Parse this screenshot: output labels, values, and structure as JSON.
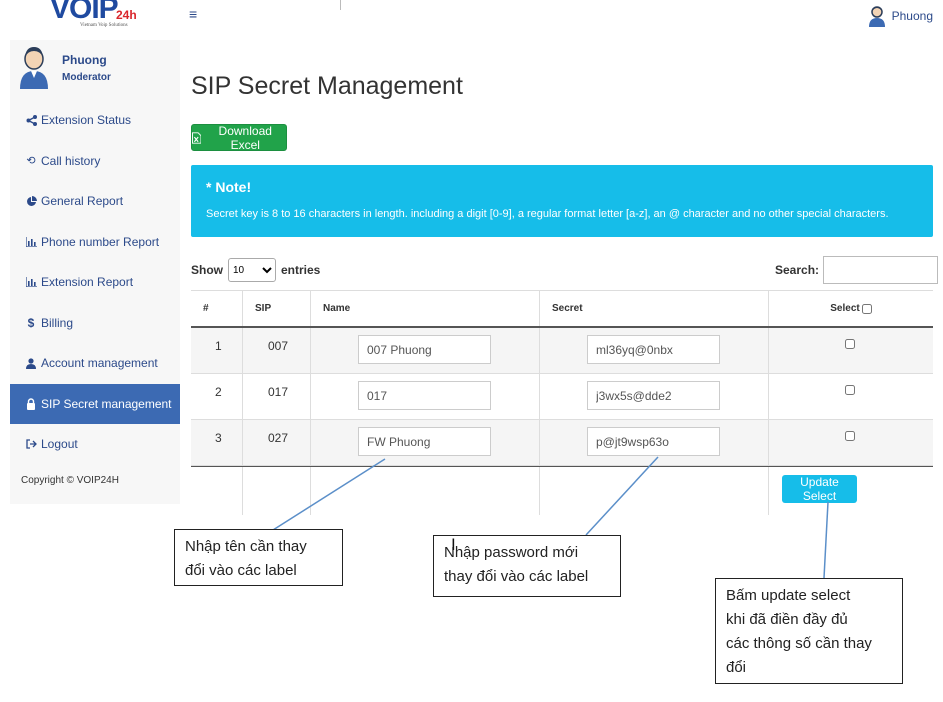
{
  "brand": {
    "logo": "VOIP",
    "logo_suffix": "24h",
    "slogan": "Vietnam Voip Solutions"
  },
  "topbar": {
    "menu_icon": "hamburger-icon",
    "user_name": "Phuong",
    "user_icon": "user-avatar-icon"
  },
  "sidebar": {
    "profile": {
      "name": "Phuong",
      "role": "Moderator"
    },
    "items": [
      {
        "label": "Extension Status",
        "icon": "share-icon"
      },
      {
        "label": "Call history",
        "icon": "history-icon"
      },
      {
        "label": "General Report",
        "icon": "pie-chart-icon"
      },
      {
        "label": "Phone number Report",
        "icon": "bar-chart-icon"
      },
      {
        "label": "Extension Report",
        "icon": "bar-chart-icon"
      },
      {
        "label": "Billing",
        "icon": "dollar-icon"
      },
      {
        "label": "Account management",
        "icon": "user-icon"
      },
      {
        "label": "SIP Secret management",
        "icon": "lock-icon",
        "active": true
      },
      {
        "label": "Logout",
        "icon": "logout-icon"
      }
    ],
    "copyright": "Copyright © VOIP24H"
  },
  "page": {
    "title": "SIP Secret Management",
    "download_label": "Download Excel"
  },
  "note": {
    "title": "* Note!",
    "text": "Secret key is 8 to 16 characters in length. including a digit [0-9], a regular format letter [a-z], an @ character and no other special characters."
  },
  "controls": {
    "show_label": "Show",
    "entries_value": "10",
    "entries_label": "entries",
    "search_label": "Search:",
    "search_value": ""
  },
  "table": {
    "headers": {
      "num": "#",
      "sip": "SIP",
      "name": "Name",
      "secret": "Secret",
      "select": "Select"
    },
    "rows": [
      {
        "num": "1",
        "sip": "007",
        "name": "007 Phuong",
        "secret": "ml36yq@0nbx",
        "checked": false
      },
      {
        "num": "2",
        "sip": "017",
        "name": "017",
        "secret": "j3wx5s@dde2",
        "checked": false
      },
      {
        "num": "3",
        "sip": "027",
        "name": "FW Phuong",
        "secret": "p@jt9wsp63o",
        "checked": false
      }
    ],
    "update_label": "Update Select"
  },
  "annotations": {
    "name_hint": [
      "Nhập tên cần thay",
      "đổi vào các label"
    ],
    "password_hint": [
      "Nhập password mới",
      "thay đổi vào các label"
    ],
    "update_hint": [
      "Bấm update select",
      "khi đã điền đầy đủ",
      "các thông số cần thay",
      "đổi"
    ]
  },
  "colors": {
    "brand_blue": "#1f4aa0",
    "sidebar_active": "#3c6ab3",
    "info": "#16bde9",
    "success": "#21a34a",
    "annotation_line": "#5b8fc9"
  }
}
